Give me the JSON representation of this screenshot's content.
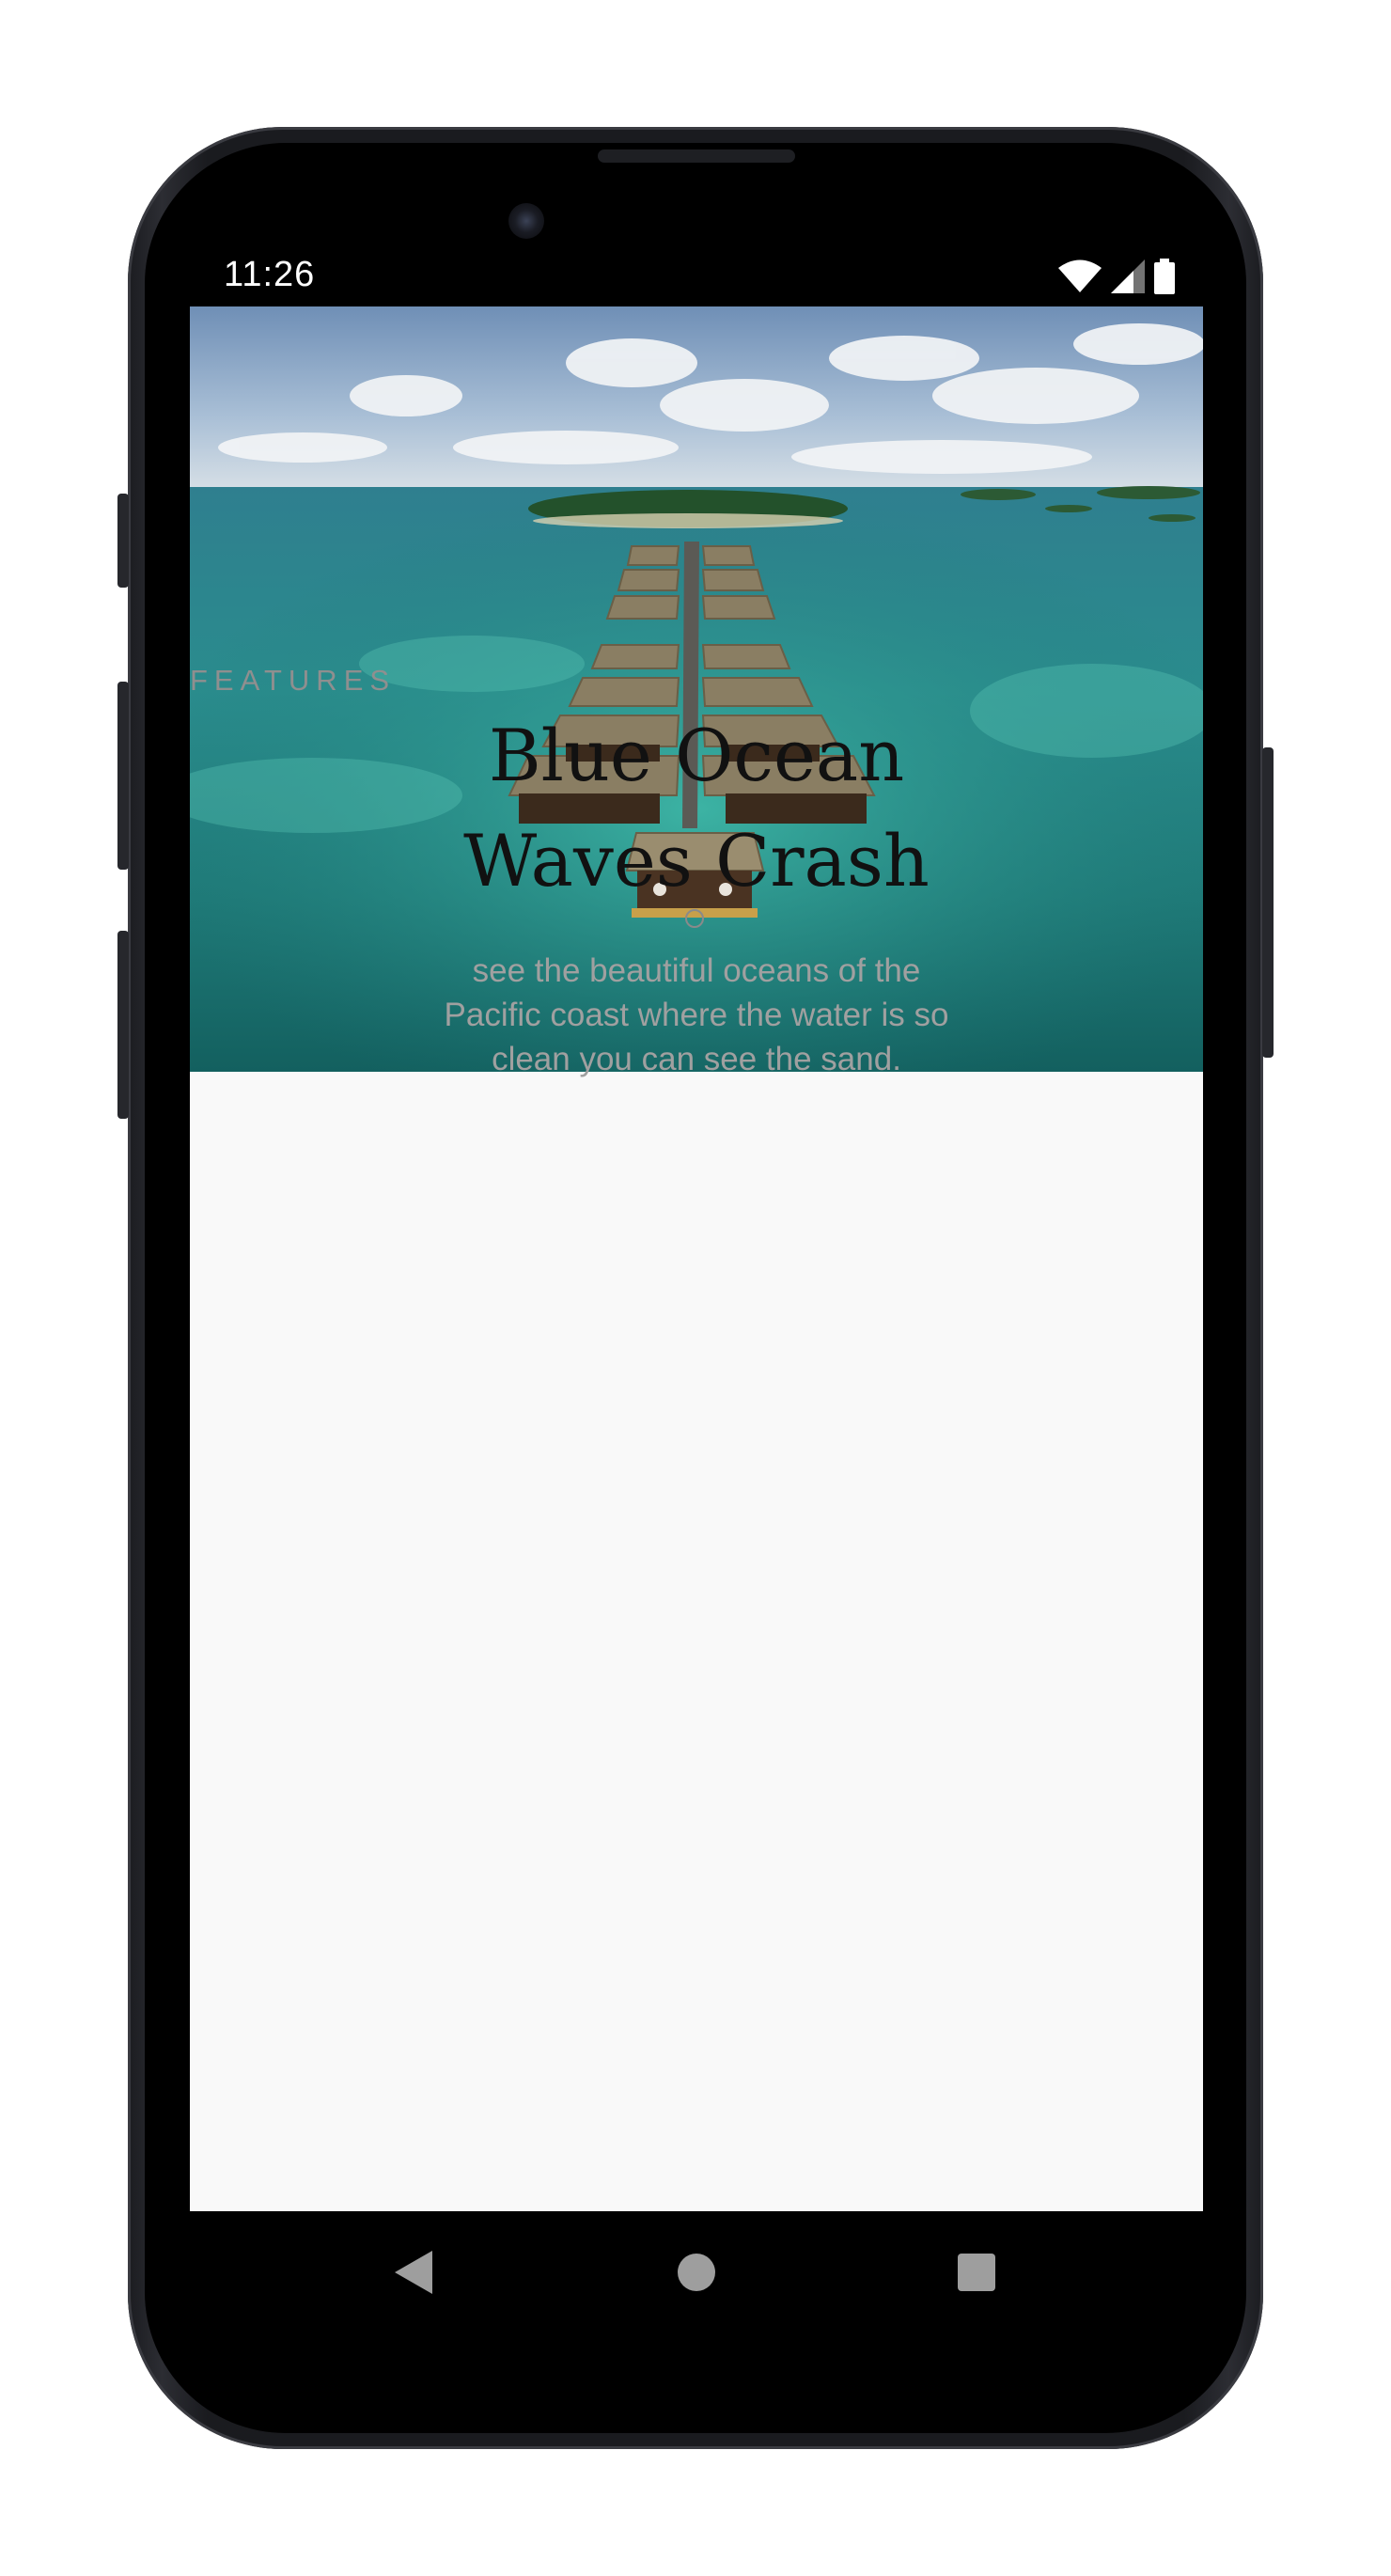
{
  "status_bar": {
    "time": "11:26",
    "icons": [
      "wifi-icon",
      "cellular-signal-icon",
      "battery-icon"
    ]
  },
  "hero": {
    "image": "aerial-overwater-bungalows-image"
  },
  "article": {
    "eyebrow": "FEATURES",
    "title_line1": "Blue Ocean",
    "title_line2": "Waves Crash",
    "description_line1": "see the beautiful oceans of the",
    "description_line2": "Pacific coast where the water is so",
    "description_line3": "clean you can see the sand."
  },
  "nav_bar": {
    "buttons": [
      "back-icon",
      "home-icon",
      "recents-icon"
    ]
  },
  "colors": {
    "screen_background": "#f9f9f9",
    "title": "#111111",
    "eyebrow": "#8f8f8f",
    "description": "#a0a0a0",
    "phone_frame": "#1b1c20",
    "nav_icons": "#9e9e9e"
  }
}
